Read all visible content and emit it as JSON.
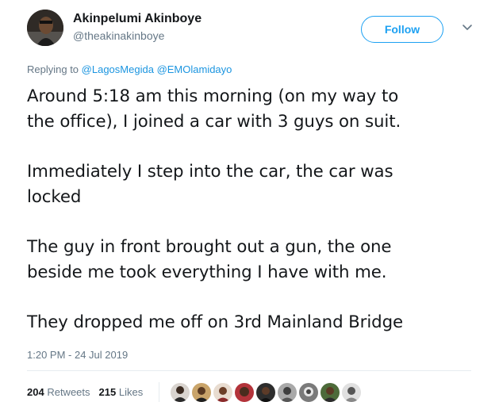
{
  "tweet": {
    "display_name": "Akinpelumi Akinboye",
    "handle": "@theakinakinboye",
    "follow_label": "Follow",
    "replying_prefix": "Replying to",
    "mentions": [
      "@LagosMegida",
      "@EMOlamidayo"
    ],
    "body_paragraphs": [
      [
        "Around 5:18 am this morning (on my way to",
        "the office), I joined a car with 3 guys on suit."
      ],
      [
        "Immediately I step into the car, the car was",
        "locked"
      ],
      [
        "The guy in front brought out a gun, the one",
        "beside me took everything I have with me."
      ],
      [
        "They dropped me off on 3rd Mainland Bridge"
      ]
    ],
    "timestamp": "1:20 PM - 24 Jul 2019",
    "retweets_count": "204",
    "retweets_label": "Retweets",
    "likes_count": "215",
    "likes_label": "Likes"
  },
  "colors": {
    "accent": "#1da1f2",
    "mention": "#1b95e0",
    "secondary_text": "#657786",
    "primary_text": "#14171a",
    "divider": "#e6ecf0"
  },
  "icons": {
    "caret": "chevron-down-icon",
    "avatar": "user-avatar-icon"
  }
}
